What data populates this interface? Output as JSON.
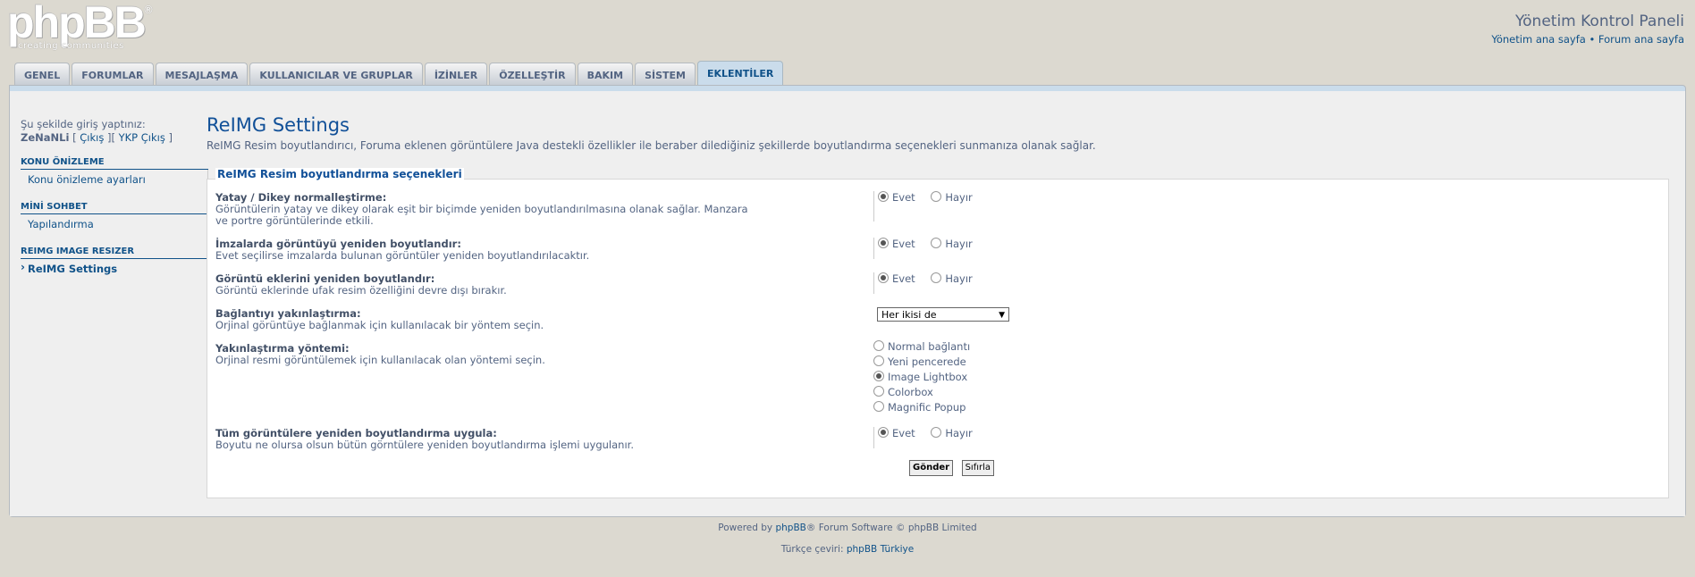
{
  "header": {
    "logo_text": "phpBB",
    "logo_reg": "®",
    "logo_tagline": "creating communities",
    "title": "Yönetim Kontrol Paneli",
    "link_admin_home": "Yönetim ana sayfa",
    "link_separator": "•",
    "link_forum_home": "Forum ana sayfa"
  },
  "tabs": [
    {
      "label": "GENEL"
    },
    {
      "label": "FORUMLAR"
    },
    {
      "label": "MESAJLAŞMA"
    },
    {
      "label": "KULLANICILAR VE GRUPLAR"
    },
    {
      "label": "İZİNLER"
    },
    {
      "label": "ÖZELLEŞTİR"
    },
    {
      "label": "BAKIM"
    },
    {
      "label": "SİSTEM"
    },
    {
      "label": "EKLENTİLER",
      "active": true
    }
  ],
  "sidebar": {
    "logged_in_as": "Şu şekilde giriş yaptınız:",
    "username": "ZeNaNLi",
    "logout_open": "[ ",
    "logout": "Çıkış",
    "logout_mid": " ][ ",
    "acp_logout": "YKP Çıkış",
    "logout_close": " ]",
    "sections": [
      {
        "title": "KONU ÖNİZLEME",
        "items": [
          "Konu önizleme ayarları"
        ]
      },
      {
        "title": "MİNİ SOHBET",
        "items": [
          "Yapılandırma"
        ]
      },
      {
        "title": "REIMG IMAGE RESIZER",
        "items": [
          "ReIMG Settings"
        ]
      }
    ]
  },
  "main": {
    "title": "ReIMG Settings",
    "description": "ReIMG Resim boyutlandırıcı, Foruma eklenen görüntülere Java destekli özellikler ile beraber dilediğiniz şekillerde boyutlandırma seçenekleri sunmanıza olanak sağlar.",
    "legend": "ReIMG Resim boyutlandırma seçenekleri",
    "yes": "Evet",
    "no": "Hayır",
    "rows": [
      {
        "title": "Yatay / Dikey normalleştirme:",
        "explain": "Görüntülerin yatay ve dikey olarak eşit bir biçimde yeniden boyutlandırılmasına olanak sağlar. Manzara ve portre görüntülerinde etkili.",
        "value": "Evet"
      },
      {
        "title": "İmzalarda görüntüyü yeniden boyutlandır:",
        "explain": "Evet seçilirse imzalarda bulunan görüntüler yeniden boyutlandırılacaktır.",
        "value": "Evet"
      },
      {
        "title": "Görüntü eklerini yeniden boyutlandır:",
        "explain": "Görüntü eklerinde ufak resim özelliğini devre dışı bırakır.",
        "value": "Evet"
      },
      {
        "title": "Bağlantıyı yakınlaştırma:",
        "explain": "Orjinal görüntüye bağlanmak için kullanılacak bir yöntem seçin.",
        "select_value": "Her ikisi de"
      },
      {
        "title": "Yakınlaştırma yöntemi:",
        "explain": "Orjinal resmi görüntülemek için kullanılacak olan yöntemi seçin.",
        "options": [
          "Normal bağlantı",
          "Yeni pencerede",
          "Image Lightbox",
          "Colorbox",
          "Magnific Popup"
        ],
        "selected": "Image Lightbox"
      },
      {
        "title": "Tüm görüntülere yeniden boyutlandırma uygula:",
        "explain": "Boyutu ne olursa olsun bütün görntülere yeniden boyutlandırma işlemi uygulanır.",
        "value": "Evet"
      }
    ],
    "submit": "Gönder",
    "reset": "Sıfırla"
  },
  "footer": {
    "powered_prefix": "Powered by ",
    "powered_link": "phpBB",
    "powered_suffix": "® Forum Software © phpBB Limited",
    "translation_prefix": "Türkçe çeviri: ",
    "translation_link": "phpBB Türkiye"
  }
}
